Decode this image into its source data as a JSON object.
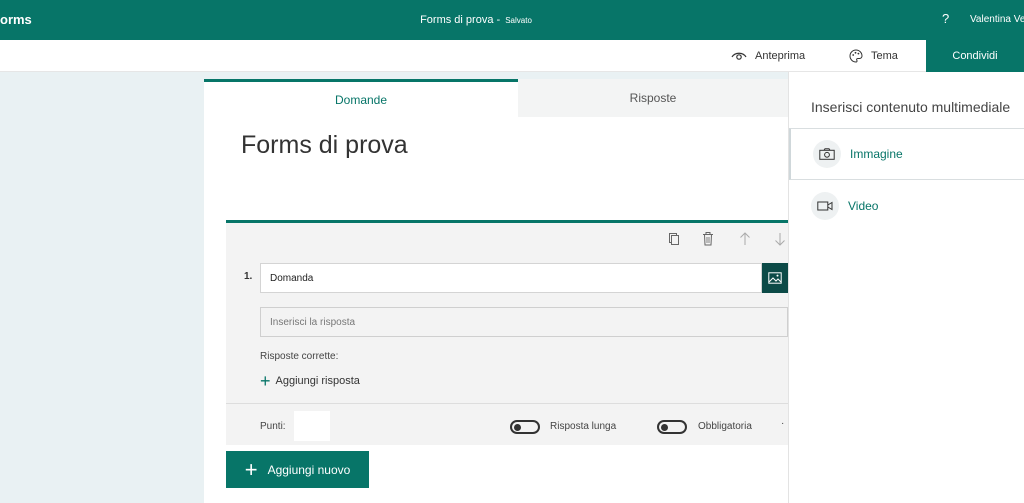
{
  "topbar": {
    "brand": "orms",
    "doc_title": "Forms di prova",
    "separator": " - ",
    "saved_status": "Salvato",
    "help_glyph": "?",
    "user_name": "Valentina Ve"
  },
  "cmdbar": {
    "preview_label": "Anteprima",
    "preview_icon": "eye-icon",
    "theme_label": "Tema",
    "theme_icon": "palette-icon",
    "share_label": "Condividi"
  },
  "tabs": {
    "questions": "Domande",
    "responses": "Risposte"
  },
  "form": {
    "title": "Forms di prova"
  },
  "question": {
    "number": "1.",
    "text": "Domanda",
    "answer_placeholder": "Inserisci la risposta",
    "correct_label": "Risposte corrette:",
    "add_answer_plus": "+",
    "add_answer_label": "Aggiungi risposta",
    "points_label": "Punti:",
    "long_answer_label": "Risposta lunga",
    "required_label": "Obbligatoria",
    "more_glyph": "·",
    "tools": [
      "copy-icon",
      "delete-icon",
      "move-up-icon",
      "move-down-icon"
    ]
  },
  "add_new": {
    "plus": "+",
    "label": "Aggiungi nuovo"
  },
  "media_panel": {
    "title": "Inserisci contenuto multimediale",
    "items": [
      {
        "label": "Immagine",
        "icon": "camera-icon"
      },
      {
        "label": "Video",
        "icon": "video-camera-icon"
      }
    ]
  },
  "colors": {
    "accent": "#077568",
    "canvas": "#e9f1f3",
    "dark_teal": "#0c4a47"
  }
}
